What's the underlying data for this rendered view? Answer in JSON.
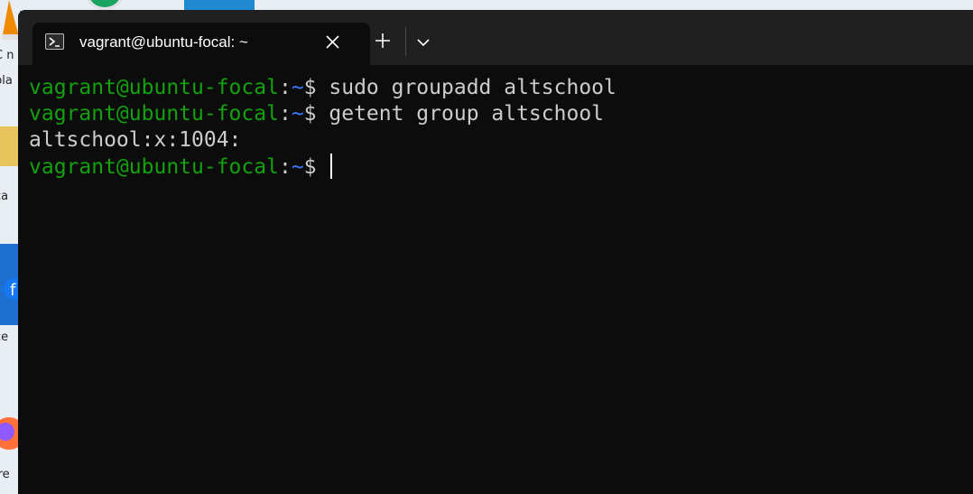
{
  "window": {
    "tab_title": "vagrant@ubuntu-focal: ~",
    "tab_icon": "powershell-icon",
    "close_icon": "close-icon",
    "new_tab_icon": "plus-icon",
    "dropdown_icon": "chevron-down-icon"
  },
  "terminal": {
    "colors": {
      "user": "#13a10e",
      "path": "#3b78ff",
      "text": "#cccccc",
      "background": "#0c0c0c"
    },
    "lines": [
      {
        "user": "vagrant@ubuntu-focal",
        "sep": ":",
        "path": "~",
        "prompt": "$ ",
        "command": "sudo groupadd altschool"
      },
      {
        "user": "vagrant@ubuntu-focal",
        "sep": ":",
        "path": "~",
        "prompt": "$ ",
        "command": "getent group altschool"
      },
      {
        "output": "altschool:x:1004:"
      },
      {
        "user": "vagrant@ubuntu-focal",
        "sep": ":",
        "path": "~",
        "prompt": "$ ",
        "command": ""
      }
    ]
  },
  "desktop": {
    "fragments": [
      "C n",
      "pla",
      "ca",
      "ce",
      "ire"
    ]
  }
}
